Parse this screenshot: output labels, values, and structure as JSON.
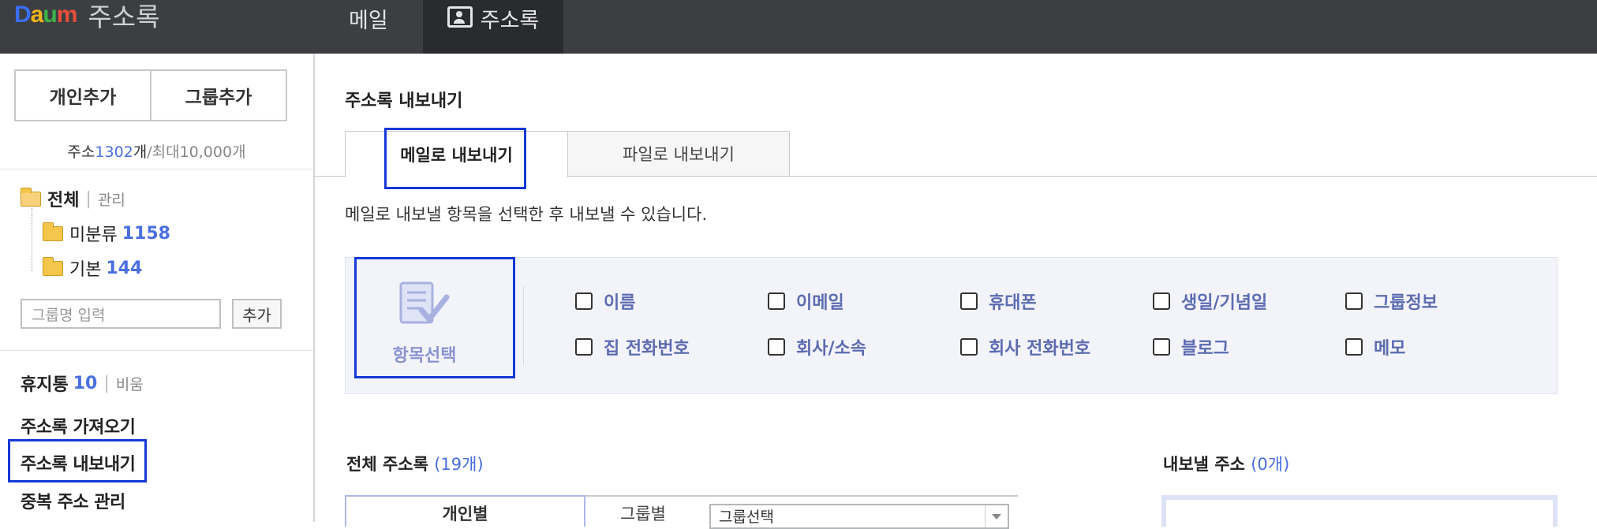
{
  "header": {
    "logo_brand": "Daum",
    "logo_title": "주소록",
    "nav_mail": "메일",
    "nav_addressbook": "주소록",
    "colors": {
      "bg": "#3d3e42",
      "active_tab_bg": "#2a2b2e"
    }
  },
  "sidebar": {
    "add_person": "개인추가",
    "add_group": "그룹추가",
    "count_prefix": "주소",
    "count_value": "1302",
    "count_unit": "개",
    "count_max": "/최대10,000개",
    "tree": {
      "all_label": "전체",
      "manage_label": "관리",
      "groups": [
        {
          "name": "미분류",
          "count": "1158"
        },
        {
          "name": "기본",
          "count": "144"
        }
      ]
    },
    "group_input_placeholder": "그룹명 입력",
    "group_add_button": "추가",
    "trash_label": "휴지통",
    "trash_count": "10",
    "empty_label": "비움",
    "links": [
      "주소록 가져오기",
      "주소록 내보내기",
      "중복 주소 관리"
    ]
  },
  "main": {
    "title": "주소록 내보내기",
    "tabs": [
      {
        "label": "메일로 내보내기",
        "active": true
      },
      {
        "label": "파일로 내보내기",
        "active": false
      }
    ],
    "description": "메일로 내보낼 항목을 선택한 후 내보낼 수 있습니다.",
    "select_label": "항목선택",
    "options": [
      {
        "label": "이름",
        "checked": false
      },
      {
        "label": "이메일",
        "checked": false
      },
      {
        "label": "휴대폰",
        "checked": false
      },
      {
        "label": "생일/기념일",
        "checked": false
      },
      {
        "label": "그룹정보",
        "checked": false
      },
      {
        "label": "집 전화번호",
        "checked": false
      },
      {
        "label": "회사/소속",
        "checked": false
      },
      {
        "label": "회사 전화번호",
        "checked": false
      },
      {
        "label": "블로그",
        "checked": false
      },
      {
        "label": "메모",
        "checked": false
      }
    ],
    "all_list_title": "전체 주소록",
    "all_list_count": "(19개)",
    "export_list_title": "내보낼 주소",
    "export_list_count": "(0개)",
    "subtab_person": "개인별",
    "group_by_label": "그룹별",
    "group_select_value": "그룹선택"
  }
}
